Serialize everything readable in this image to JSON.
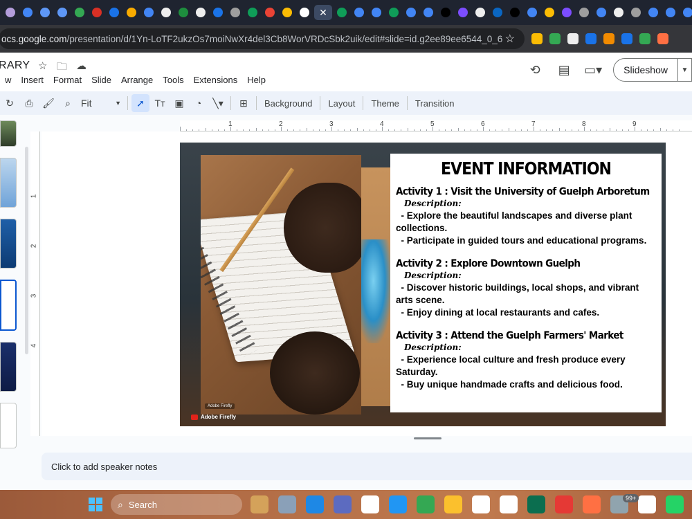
{
  "browser": {
    "tab_colors": [
      "#b39ddb",
      "#4285f4",
      "#5e97f6",
      "#5e97f6",
      "#34a853",
      "#d93025",
      "#1a73e8",
      "#f9ab00",
      "#4285f4",
      "#eeeeee",
      "#1e8e3e",
      "#eeeeee",
      "#1a73e8",
      "#9e9e9e",
      "#0f9d58",
      "#ea4335",
      "#fbbc04",
      "#ffffff",
      "#0f9d58",
      "#4285f4",
      "#4285f4",
      "#0f9d58",
      "#4285f4",
      "#4285f4",
      "#000000",
      "#7c4dff",
      "#eeeeee",
      "#0a66c2",
      "#000000",
      "#4285f4",
      "#fbbc04",
      "#7c4dff",
      "#9e9e9e",
      "#4285f4",
      "#eeeeee",
      "#9e9e9e",
      "#4285f4",
      "#4285f4",
      "#4285f4",
      "#ff7043"
    ],
    "active_tab_close": "✕",
    "url_host": "ocs.google.com",
    "url_path": "/presentation/d/1Yn-LoTF2ukzOs7moiNwXr4del3Cb8WorVRDcSbk2uik/edit#slide=id.g2ee89ee6544_0_6",
    "ext_colors": [
      "#fbbc04",
      "#34a853",
      "#eeeeee",
      "#1a73e8",
      "#f28b00",
      "#1a73e8",
      "#34a853",
      "#ff7043"
    ]
  },
  "docs": {
    "title": "RARY",
    "menus": [
      "w",
      "Insert",
      "Format",
      "Slide",
      "Arrange",
      "Tools",
      "Extensions",
      "Help"
    ],
    "slideshow_label": "Slideshow"
  },
  "toolbar": {
    "zoom": "Fit",
    "background": "Background",
    "layout": "Layout",
    "theme": "Theme",
    "transition": "Transition"
  },
  "rulers": {
    "h": [
      "1",
      "2",
      "3",
      "4",
      "5",
      "6",
      "7",
      "8",
      "9"
    ],
    "v": [
      "1",
      "2",
      "3",
      "4"
    ]
  },
  "slide": {
    "heading": "EVENT INFORMATION",
    "badge": "Adobe Firefly",
    "watermark": "Adobe Firefly",
    "activities": [
      {
        "title": "Activity 1 : Visit the University of Guelph Arboretum",
        "desc": "Description:",
        "bullets": [
          "  - Explore the beautiful landscapes and diverse plant collections.",
          "  - Participate in guided tours and educational programs."
        ]
      },
      {
        "title": "Activity 2 : Explore Downtown Guelph",
        "desc": "Description:",
        "bullets": [
          "  - Discover historic buildings, local shops, and vibrant arts scene.",
          "  - Enjoy dining at local restaurants and cafes."
        ]
      },
      {
        "title": " Activity 3 : Attend the Guelph Farmers' Market",
        "desc": "Description:",
        "bullets": [
          "  - Experience local culture and fresh produce every Saturday.",
          "  - Buy unique handmade crafts and delicious food."
        ]
      }
    ]
  },
  "notes": {
    "placeholder": "Click to add speaker notes"
  },
  "taskbar": {
    "search_label": "Search",
    "notification_count": "99+",
    "app_colors": [
      "#d4a25a",
      "#8aa0b8",
      "#1e88e5",
      "#5c6bc0",
      "#ffffff",
      "#2196f3",
      "#34a853",
      "#fbc02d",
      "#ffffff",
      "#ffffff",
      "#0b6e4f",
      "#e53935",
      "#ff7043",
      "#90a4ae",
      "#ffffff",
      "#25d366"
    ]
  }
}
